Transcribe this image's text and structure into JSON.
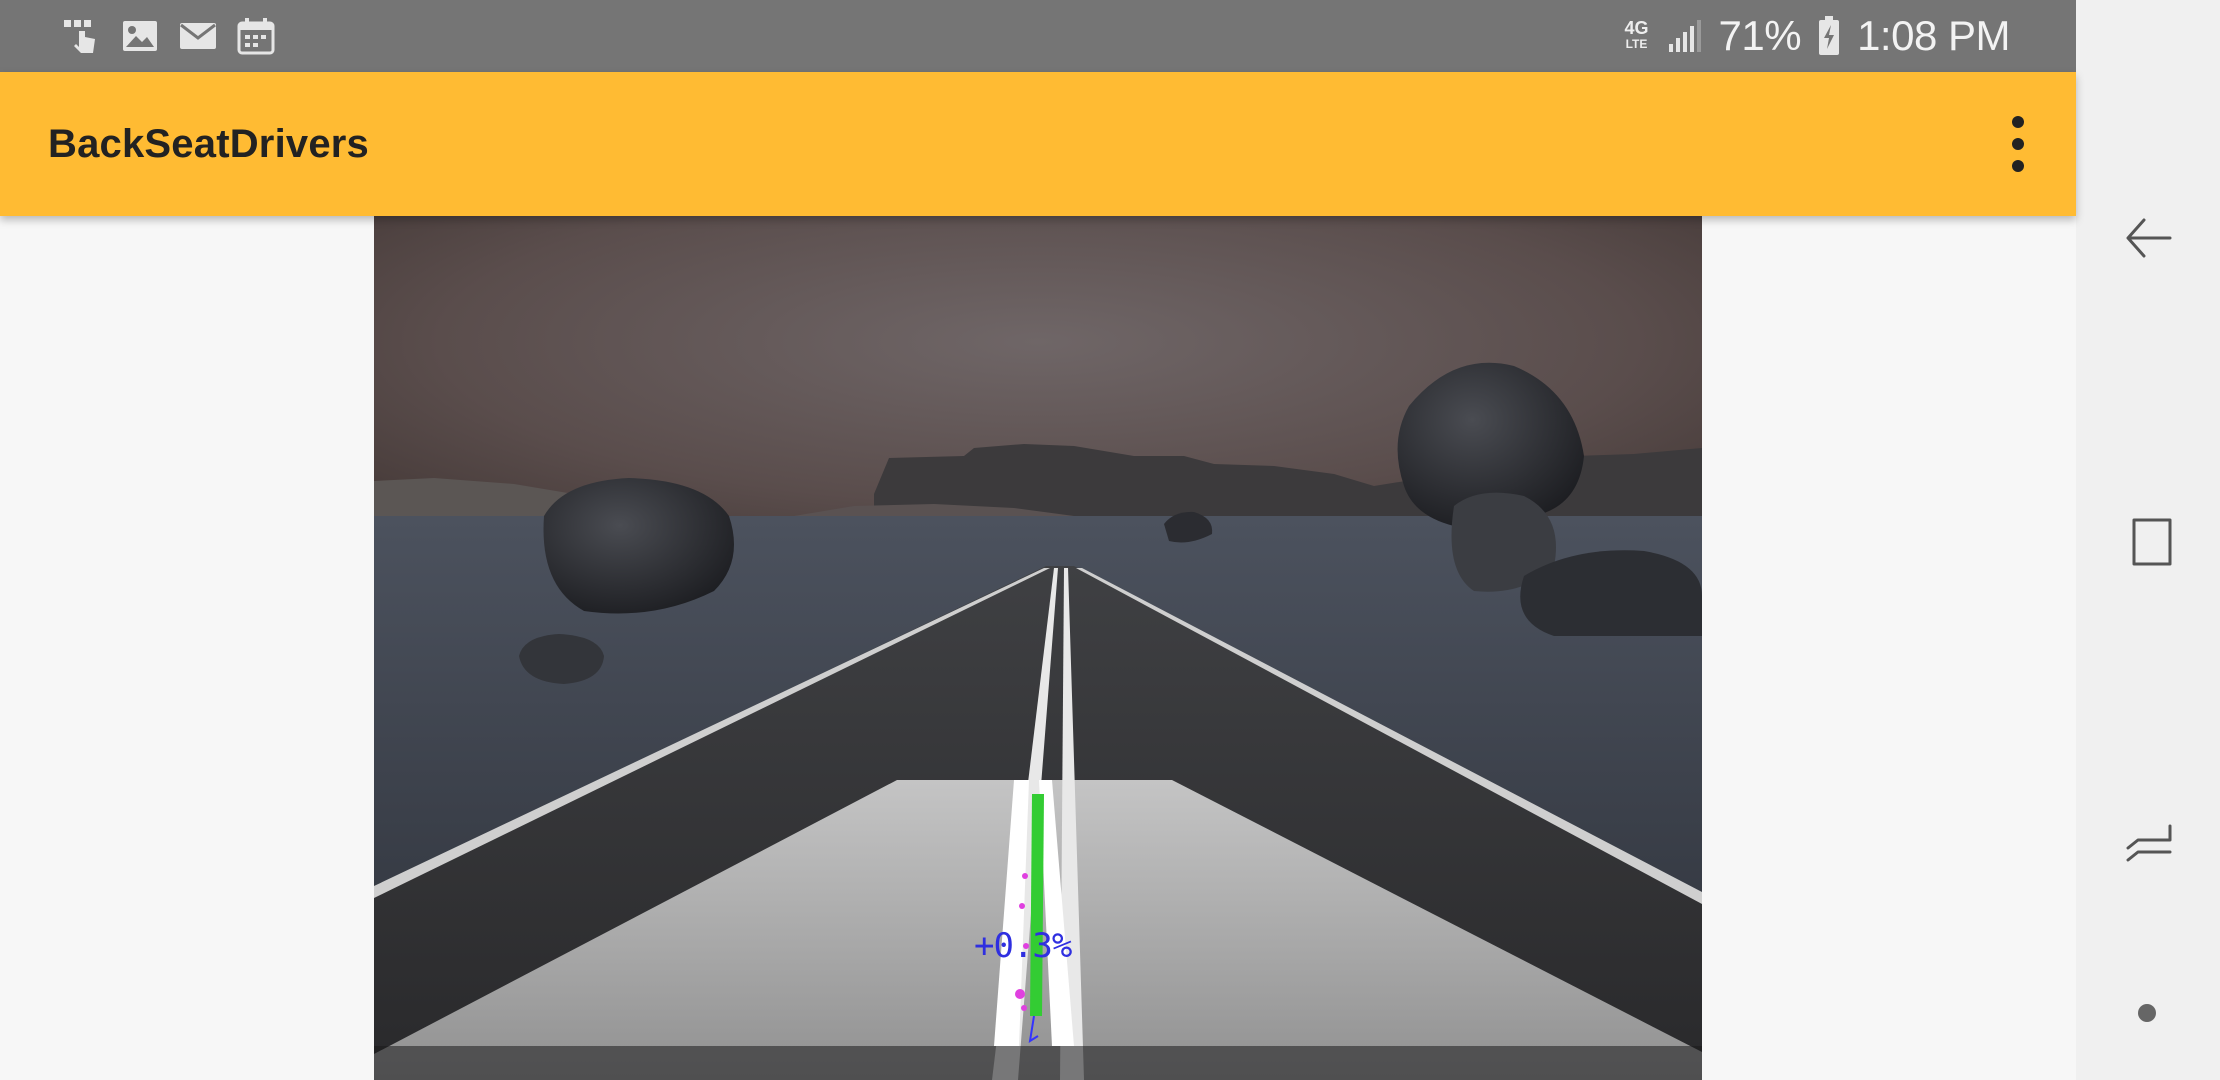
{
  "status_bar": {
    "network_type": "4G",
    "network_sub": "LTE",
    "battery": "71%",
    "time": "1:08 PM",
    "notification_icons": [
      "voicemail-icon",
      "gallery-icon",
      "mail-icon",
      "calendar-icon"
    ]
  },
  "app_bar": {
    "title": "BackSeatDrivers",
    "color": "#FFBB33"
  },
  "camera": {
    "lane_offset_label": "+0.3%",
    "overlay_color": "#33CC33"
  },
  "nav_bar": {
    "buttons": [
      "back-icon",
      "recents-icon",
      "home-icon",
      "assistant-dot-icon"
    ]
  }
}
